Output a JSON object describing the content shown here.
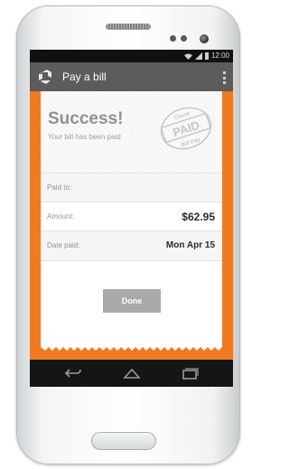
{
  "status_bar": {
    "time": "12:00"
  },
  "app_bar": {
    "title": "Pay a bill",
    "logo": "chase-logo-icon",
    "menu_icon": "overflow-menu-icon"
  },
  "success": {
    "title": "Success!",
    "subtitle": "Your bill has been paid"
  },
  "stamp": {
    "top_text": "Chase",
    "main_text": "PAID",
    "bottom_text": "Bill Pay"
  },
  "details": [
    {
      "label": "Paid to:",
      "value": ""
    },
    {
      "label": "Amount:",
      "value": "$62.95"
    },
    {
      "label": "Date paid:",
      "value": "Mon Apr 15"
    }
  ],
  "done_label": "Done",
  "nav": {
    "back_icon": "back-icon",
    "home_icon": "home-icon",
    "recents_icon": "recent-apps-icon"
  },
  "colors": {
    "accent": "#f07a21",
    "app_bar": "#5c5c5c",
    "button": "#a9a9a9"
  }
}
